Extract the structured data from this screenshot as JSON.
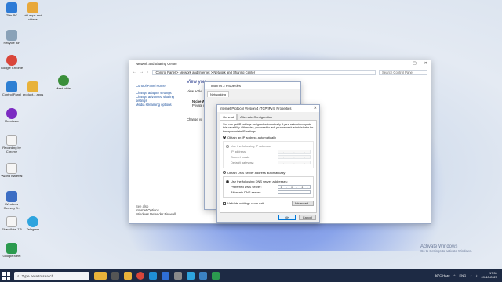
{
  "desktop": {
    "icons": [
      {
        "label": "This PC",
        "color": "#2e7bd6"
      },
      {
        "label": "vld apps and videos",
        "color": "#e8a83a"
      },
      {
        "label": "Recycle Bin",
        "color": "#8aa2b8"
      },
      {
        "label": "Google Chrome",
        "color": "#d9463a"
      },
      {
        "label": "Control Panel",
        "color": "#2d7fd3"
      },
      {
        "label": "Camtasia Recorder",
        "color": "#3a8f3a"
      },
      {
        "label": "Camtasia",
        "color": "#7b2bc2"
      },
      {
        "label": "Recording by Chrome",
        "color": "#e0e0e0"
      },
      {
        "label": "vworld material",
        "color": "#ececec"
      },
      {
        "label": "Windows Memory D..",
        "color": "#3c6ec4"
      },
      {
        "label": "ShareWire 7.5",
        "color": "#ececec"
      },
      {
        "label": "Telegram",
        "color": "#2ea4de"
      },
      {
        "label": "Google Meet",
        "color": "#2b9a4f"
      }
    ],
    "extra_icons": [
      {
        "label": "product... apps",
        "color": "#e8b23a"
      },
      {
        "label": "Meet folder",
        "color": "#3a8f3a"
      }
    ]
  },
  "nsc": {
    "title": "Network and Sharing Center",
    "breadcrumb": [
      "Control Panel",
      "Network and Internet",
      "Network and Sharing Center"
    ],
    "search_placeholder": "Search Control Panel",
    "side_links": [
      "Control Panel Home",
      "Change adapter settings",
      "Change advanced sharing settings",
      "Media streaming options"
    ],
    "see_also": "See also",
    "see_also_links": [
      "Internet Options",
      "Windows Defender Firewall"
    ],
    "main_heading": "View you",
    "main_sub1": "View activ",
    "main_name": "Niche W",
    "main_private": "Private n",
    "change_label": "Change yo"
  },
  "props": {
    "title": "Internet 2 Properties",
    "tab": "Networking"
  },
  "ipv4": {
    "title": "Internet Protocol Version 4 (TCP/IPv4) Properties",
    "tabs": [
      "General",
      "Alternate Configuration"
    ],
    "info": "You can get IP settings assigned automatically if your network supports this capability. Otherwise, you need to ask your network administrator for the appropriate IP settings.",
    "auto_ip": "Obtain an IP address automatically",
    "manual_ip": "Use the following IP address:",
    "ip_label": "IP address:",
    "subnet_label": "Subnet mask:",
    "gateway_label": "Default gateway:",
    "auto_dns": "Obtain DNS server address automatically",
    "manual_dns": "Use the following DNS server addresses:",
    "pref_dns_label": "Preferred DNS server:",
    "pref_dns": [
      "1",
      "1",
      "1"
    ],
    "alt_dns_label": "Alternate DNS server:",
    "validate": "Validate settings upon exit",
    "advanced": "Advanced...",
    "ok": "OK",
    "cancel": "Cancel"
  },
  "activate": {
    "line1": "Activate Windows",
    "line2": "Go to Settings to activate Windows."
  },
  "taskbar": {
    "search": "Type here to search",
    "weather": "36°C Haze",
    "lang": "ENG",
    "time": "17:54",
    "date": "09-10-2023"
  }
}
